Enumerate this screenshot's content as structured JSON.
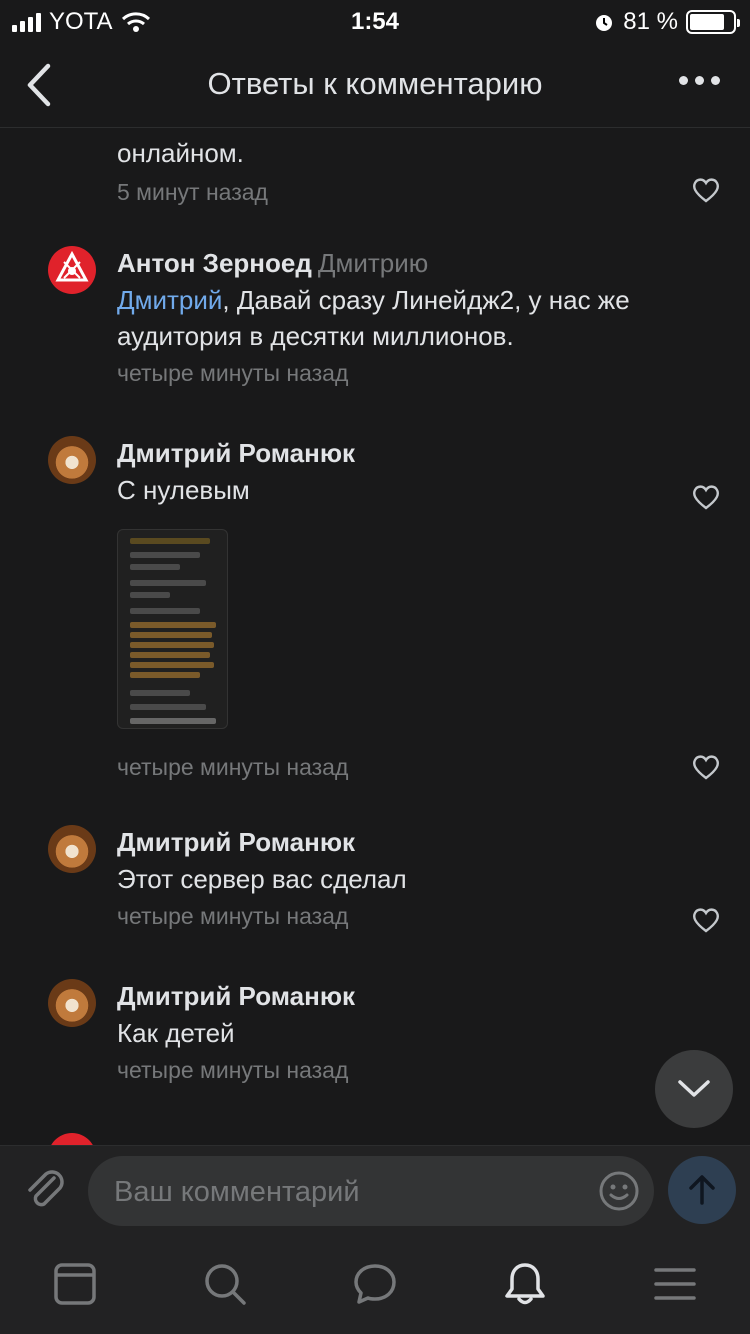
{
  "status": {
    "carrier": "YOTA",
    "time": "1:54",
    "battery": "81 %",
    "battery_level": 0.81
  },
  "nav": {
    "title": "Ответы к комментарию"
  },
  "comments": [
    {
      "text": "онлайном.",
      "time": "5 минут назад"
    },
    {
      "author": "Антон Зерноед",
      "reply_to": "Дмитрию",
      "mention": "Дмитрий",
      "text": ", Давай сразу Линейдж2, у нас же аудитория в десятки миллионов.",
      "time": "четыре минуты назад"
    },
    {
      "author": "Дмитрий Романюк",
      "text": "С нулевым",
      "time": "четыре минуты назад"
    },
    {
      "author": "Дмитрий Романюк",
      "text": "Этот сервер вас сделал",
      "time": "четыре минуты назад"
    },
    {
      "author": "Дмитрий Романюк",
      "text": "Как детей",
      "time": "четыре минуты назад"
    }
  ],
  "composer": {
    "placeholder": "Ваш комментарий"
  },
  "icons": {
    "back": "chevron-left-icon",
    "more": "more-dots-icon",
    "like": "heart-icon",
    "scroll": "chevron-down-icon",
    "attach": "paperclip-icon",
    "emoji": "smile-icon",
    "send": "arrow-up-icon",
    "tabs": [
      "news-icon",
      "search-icon",
      "messages-icon",
      "notifications-icon",
      "menu-icon"
    ]
  },
  "colors": {
    "background": "#19191a",
    "text": "#e1e3e6",
    "secondary": "#76787a",
    "link": "#71aaeb",
    "send_button": "#2e3f52"
  }
}
